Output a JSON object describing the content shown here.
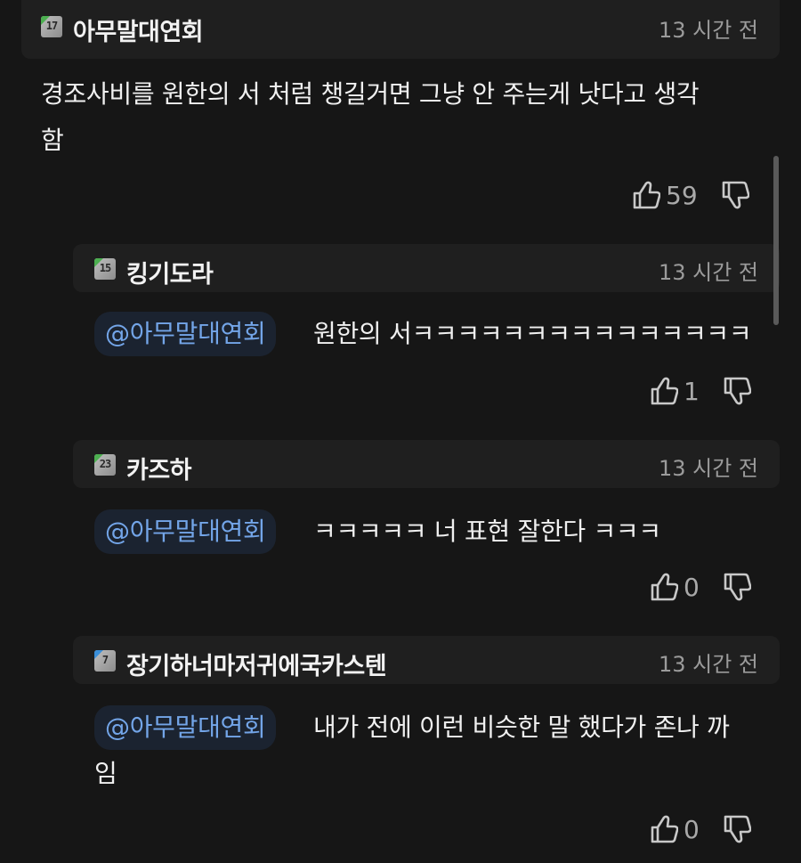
{
  "comments": [
    {
      "level": "17",
      "level_color": "#4caf50",
      "username": "아무말대연회",
      "timestamp": "13 시간 전",
      "text_line1": "경조사비를 원한의 서 처럼 챙길거면 그냥 안 주는게 낫다고 생각",
      "text_line2": "함",
      "likes": "59"
    },
    {
      "level": "15",
      "level_color": "#4caf50",
      "username": "킹기도라",
      "timestamp": "13 시간 전",
      "mention": "@아무말대연회",
      "text_line1": "원한의 서ㅋㅋㅋㅋㅋㅋㅋㅋㅋㅋㅋㅋㅋㅋㅋ",
      "likes": "1"
    },
    {
      "level": "23",
      "level_color": "#4caf50",
      "username": "카즈하",
      "timestamp": "13 시간 전",
      "mention": "@아무말대연회",
      "text_line1": "ㅋㅋㅋㅋㅋ 너 표현 잘한다 ㅋㅋㅋ",
      "likes": "0"
    },
    {
      "level": "7",
      "level_color": "#3a8fd9",
      "username": "장기하너마저귀에국카스텐",
      "timestamp": "13 시간 전",
      "mention": "@아무말대연회",
      "text_line1": "내가 전에 이런 비슷한 말 했다가 존나 까",
      "text_line2": "임",
      "likes": "0"
    }
  ],
  "icons": {
    "like": "thumbs-up-icon",
    "dislike": "thumbs-down-icon"
  },
  "colors": {
    "background": "#161616",
    "header_bg": "#1f1f1f",
    "mention_text": "#73a5e8",
    "mention_bg": "#1b2330"
  }
}
